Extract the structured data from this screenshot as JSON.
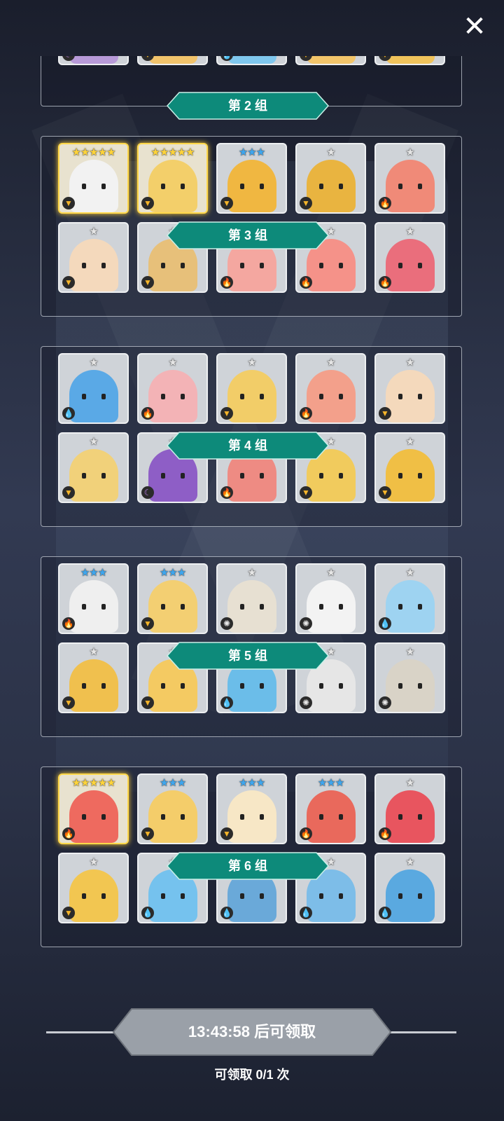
{
  "close_label": "✕",
  "groups": [
    {
      "label": "第 2 组",
      "partial": true,
      "cards": [
        {
          "stars": 0,
          "rarity": "white",
          "element": "moon",
          "color": "#b79ad8"
        },
        {
          "stars": 0,
          "rarity": "white",
          "element": "earth",
          "color": "#f1c36b"
        },
        {
          "stars": 0,
          "rarity": "white",
          "element": "water",
          "color": "#7fc7ee"
        },
        {
          "stars": 0,
          "rarity": "white",
          "element": "earth",
          "color": "#f2c56a"
        },
        {
          "stars": 0,
          "rarity": "white",
          "element": "earth",
          "color": "#f0c35b"
        }
      ]
    },
    {
      "label": "第 3 组",
      "cards": [
        {
          "stars": 5,
          "rarity": "gold",
          "element": "earth",
          "color": "#f2f2f2"
        },
        {
          "stars": 5,
          "rarity": "gold",
          "element": "earth",
          "color": "#f3cf6a"
        },
        {
          "stars": 3,
          "rarity": "blue",
          "element": "earth",
          "color": "#f0b741"
        },
        {
          "stars": 1,
          "rarity": "white",
          "element": "earth",
          "color": "#e9b440"
        },
        {
          "stars": 1,
          "rarity": "white",
          "element": "fire",
          "color": "#f08a78"
        },
        {
          "stars": 1,
          "rarity": "white",
          "element": "earth",
          "color": "#f4d9bc"
        },
        {
          "stars": 1,
          "rarity": "white",
          "element": "earth",
          "color": "#e7c07a"
        },
        {
          "stars": 1,
          "rarity": "white",
          "element": "fire",
          "color": "#f4a7a0"
        },
        {
          "stars": 1,
          "rarity": "white",
          "element": "fire",
          "color": "#f59289"
        },
        {
          "stars": 1,
          "rarity": "white",
          "element": "fire",
          "color": "#ea6e7c"
        }
      ]
    },
    {
      "label": "第 4 组",
      "cards": [
        {
          "stars": 1,
          "rarity": "white",
          "element": "water",
          "color": "#5aa9e6"
        },
        {
          "stars": 1,
          "rarity": "white",
          "element": "fire",
          "color": "#f3b3b6"
        },
        {
          "stars": 1,
          "rarity": "white",
          "element": "earth",
          "color": "#f2cd68"
        },
        {
          "stars": 1,
          "rarity": "white",
          "element": "fire",
          "color": "#f3a08b"
        },
        {
          "stars": 1,
          "rarity": "white",
          "element": "earth",
          "color": "#f4d9bc"
        },
        {
          "stars": 1,
          "rarity": "white",
          "element": "earth",
          "color": "#f1d17a"
        },
        {
          "stars": 1,
          "rarity": "white",
          "element": "moon",
          "color": "#8e5ec6"
        },
        {
          "stars": 1,
          "rarity": "white",
          "element": "fire",
          "color": "#ee8b83"
        },
        {
          "stars": 1,
          "rarity": "white",
          "element": "earth",
          "color": "#f1cb5d"
        },
        {
          "stars": 1,
          "rarity": "white",
          "element": "earth",
          "color": "#f0bf45"
        }
      ]
    },
    {
      "label": "第 5 组",
      "cards": [
        {
          "stars": 3,
          "rarity": "blue",
          "element": "fire",
          "color": "#efefef"
        },
        {
          "stars": 3,
          "rarity": "blue",
          "element": "earth",
          "color": "#f3cf72"
        },
        {
          "stars": 1,
          "rarity": "white",
          "element": "light",
          "color": "#e7e0d2"
        },
        {
          "stars": 1,
          "rarity": "white",
          "element": "light",
          "color": "#f3f3f3"
        },
        {
          "stars": 1,
          "rarity": "white",
          "element": "water",
          "color": "#9ed3f1"
        },
        {
          "stars": 1,
          "rarity": "white",
          "element": "earth",
          "color": "#f0c04e"
        },
        {
          "stars": 1,
          "rarity": "white",
          "element": "earth",
          "color": "#f4ca62"
        },
        {
          "stars": 1,
          "rarity": "white",
          "element": "water",
          "color": "#6bbde9"
        },
        {
          "stars": 1,
          "rarity": "white",
          "element": "light",
          "color": "#e6e6e6"
        },
        {
          "stars": 1,
          "rarity": "white",
          "element": "light",
          "color": "#d9d3c7"
        }
      ]
    },
    {
      "label": "第 6 组",
      "cards": [
        {
          "stars": 5,
          "rarity": "gold",
          "element": "fire",
          "color": "#ee6a5f"
        },
        {
          "stars": 3,
          "rarity": "blue",
          "element": "earth",
          "color": "#f4cd6a"
        },
        {
          "stars": 3,
          "rarity": "blue",
          "element": "earth",
          "color": "#f7e7c6"
        },
        {
          "stars": 3,
          "rarity": "blue",
          "element": "fire",
          "color": "#e9695c"
        },
        {
          "stars": 1,
          "rarity": "white",
          "element": "fire",
          "color": "#e8555f"
        },
        {
          "stars": 1,
          "rarity": "white",
          "element": "earth",
          "color": "#f2c651"
        },
        {
          "stars": 1,
          "rarity": "white",
          "element": "water",
          "color": "#75c2ee"
        },
        {
          "stars": 1,
          "rarity": "white",
          "element": "water",
          "color": "#6aa9d9"
        },
        {
          "stars": 1,
          "rarity": "white",
          "element": "water",
          "color": "#7dbde8"
        },
        {
          "stars": 1,
          "rarity": "white",
          "element": "water",
          "color": "#5aa9e0"
        }
      ]
    }
  ],
  "claim_button_label": "13:43:58 后可领取",
  "claim_count_label": "可领取 0/1 次",
  "colors": {
    "label_band": "#0d8a7a",
    "claim_button": "#9aa0a8",
    "gold_star": "#ffd43a",
    "blue_star": "#3ea6ee",
    "white_star": "#e5e5e5"
  },
  "element_icons": {
    "fire": "🔥",
    "water": "💧",
    "earth": "▼",
    "light": "✺",
    "moon": "☾"
  }
}
